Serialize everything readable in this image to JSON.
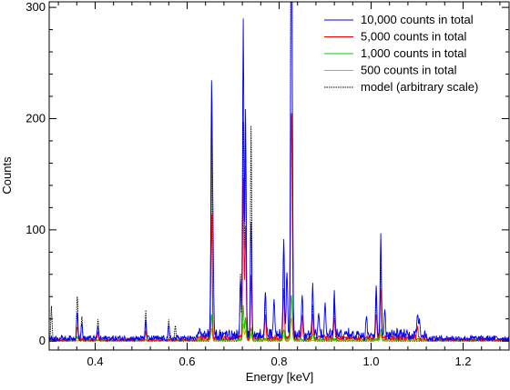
{
  "chart_data": {
    "type": "line",
    "title": "",
    "xlabel": "Energy [keV]",
    "ylabel": "Counts",
    "xlim": [
      0.3,
      1.3
    ],
    "ylim": [
      -8,
      305
    ],
    "x_ticks": [
      0.4,
      0.6,
      0.8,
      1.0,
      1.2
    ],
    "x_tick_labels": [
      "0.4",
      "0.6",
      "0.8",
      "1.0",
      "1.2"
    ],
    "y_ticks": [
      0,
      100,
      200,
      300
    ],
    "y_tick_labels": [
      "0",
      "100",
      "200",
      "300"
    ],
    "grid": false,
    "legend_position": "top-right",
    "series": [
      {
        "name": "10,000 counts in total",
        "color": "#0000ff",
        "style": "solid",
        "baseline": 2,
        "peaks": [
          [
            0.361,
            25
          ],
          [
            0.371,
            13
          ],
          [
            0.406,
            12
          ],
          [
            0.51,
            14
          ],
          [
            0.56,
            10
          ],
          [
            0.653,
            222
          ],
          [
            0.656,
            90
          ],
          [
            0.716,
            50
          ],
          [
            0.722,
            282
          ],
          [
            0.727,
            203
          ],
          [
            0.739,
            105
          ],
          [
            0.77,
            38
          ],
          [
            0.789,
            28
          ],
          [
            0.81,
            86
          ],
          [
            0.817,
            58
          ],
          [
            0.826,
            301
          ],
          [
            0.828,
            225
          ],
          [
            0.85,
            40
          ],
          [
            0.873,
            42
          ],
          [
            0.886,
            20
          ],
          [
            0.9,
            25
          ],
          [
            0.92,
            38
          ],
          [
            0.99,
            20
          ],
          [
            1.011,
            40
          ],
          [
            1.021,
            92
          ],
          [
            1.03,
            20
          ],
          [
            1.101,
            20
          ],
          [
            1.105,
            15
          ]
        ]
      },
      {
        "name": "5,000 counts in total",
        "color": "#ff0000",
        "style": "solid",
        "baseline": 1,
        "peaks": [
          [
            0.361,
            12
          ],
          [
            0.406,
            6
          ],
          [
            0.51,
            7
          ],
          [
            0.653,
            111
          ],
          [
            0.722,
            141
          ],
          [
            0.727,
            102
          ],
          [
            0.739,
            55
          ],
          [
            0.77,
            20
          ],
          [
            0.81,
            43
          ],
          [
            0.826,
            150
          ],
          [
            0.828,
            112
          ],
          [
            0.85,
            20
          ],
          [
            0.873,
            21
          ],
          [
            0.92,
            19
          ],
          [
            1.011,
            20
          ],
          [
            1.021,
            46
          ],
          [
            1.101,
            10
          ]
        ]
      },
      {
        "name": "1,000 counts in total",
        "color": "#00cc00",
        "style": "solid",
        "baseline": 0.5,
        "peaks": [
          [
            0.361,
            3
          ],
          [
            0.653,
            22
          ],
          [
            0.722,
            30
          ],
          [
            0.727,
            20
          ],
          [
            0.739,
            11
          ],
          [
            0.81,
            9
          ],
          [
            0.826,
            30
          ],
          [
            0.828,
            22
          ],
          [
            0.873,
            4
          ],
          [
            1.021,
            9
          ]
        ]
      },
      {
        "name": "500 counts in total",
        "color": "#e8a000",
        "style": "solid",
        "baseline": 0.2,
        "peaks": [
          [
            0.653,
            11
          ],
          [
            0.722,
            15
          ],
          [
            0.727,
            10
          ],
          [
            0.739,
            6
          ],
          [
            0.81,
            5
          ],
          [
            0.826,
            15
          ],
          [
            0.828,
            11
          ],
          [
            1.021,
            5
          ]
        ]
      },
      {
        "name": "model (arbitrary scale)",
        "color": "#000000",
        "style": "dotted",
        "baseline": 0,
        "peaks": [
          [
            0.305,
            30
          ],
          [
            0.361,
            45
          ],
          [
            0.371,
            20
          ],
          [
            0.406,
            20
          ],
          [
            0.51,
            25
          ],
          [
            0.56,
            18
          ],
          [
            0.574,
            15
          ],
          [
            0.653,
            185
          ],
          [
            0.716,
            60
          ],
          [
            0.722,
            205
          ],
          [
            0.727,
            180
          ],
          [
            0.739,
            170
          ],
          [
            0.77,
            40
          ],
          [
            0.81,
            80
          ],
          [
            0.826,
            300
          ],
          [
            0.828,
            250
          ],
          [
            0.873,
            35
          ],
          [
            0.92,
            30
          ],
          [
            1.011,
            40
          ],
          [
            1.021,
            70
          ]
        ]
      }
    ]
  }
}
